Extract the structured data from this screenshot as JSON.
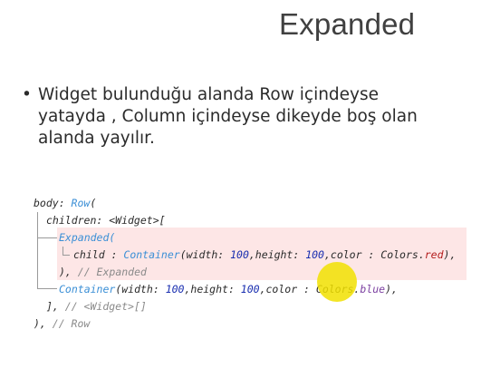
{
  "slide": {
    "title": "Expanded",
    "bullet": "Widget bulunduğu alanda Row içindeyse yatayda , Column içindeyse dikeyde boş olan alanda yayılır."
  },
  "code": {
    "l1_a": "body: ",
    "l1_b": "Row",
    "l1_c": "(",
    "l2": "children: <Widget>[",
    "l3_a": "Expanded",
    "l3_b": "(",
    "l4_a": "child : ",
    "l4_b": "Container",
    "l4_c": "(width: ",
    "l4_d": "100",
    "l4_e": ",height: ",
    "l4_f": "100",
    "l4_g": ",color : Colors.",
    "l4_h": "red",
    "l4_i": "),",
    "l5_a": "), ",
    "l5_b": "// Expanded",
    "l6_a": "Container",
    "l6_b": "(width: ",
    "l6_c": "100",
    "l6_d": ",height: ",
    "l6_e": "100",
    "l6_f": ",color : Colors.",
    "l6_g": "blue",
    "l6_h": "),",
    "l7_a": "], ",
    "l7_b": "// <Widget>[]",
    "l8_a": "), ",
    "l8_b": "// Row"
  }
}
